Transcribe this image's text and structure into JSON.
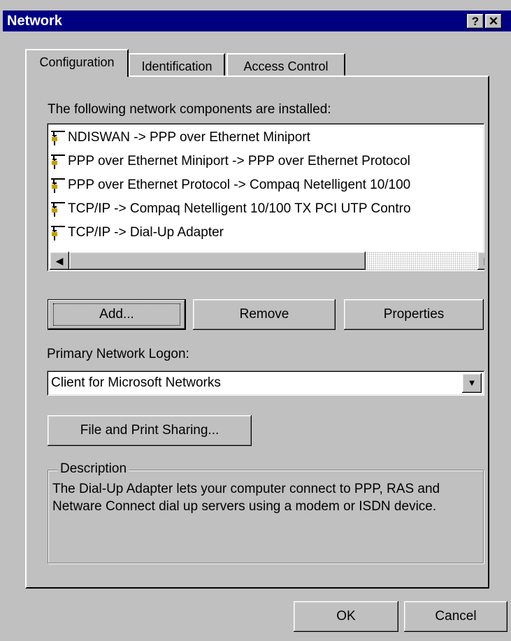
{
  "window": {
    "title": "Network",
    "help_label": "?",
    "close_label": "✕"
  },
  "tabs": [
    {
      "label": "Configuration",
      "active": true
    },
    {
      "label": "Identification",
      "active": false
    },
    {
      "label": "Access Control",
      "active": false
    }
  ],
  "components": {
    "heading": "The following network components are installed:",
    "items": [
      {
        "icon": "network-cable-icon",
        "label": "NDISWAN -> PPP over Ethernet Miniport"
      },
      {
        "icon": "network-cable-icon",
        "label": "PPP over Ethernet Miniport -> PPP over Ethernet Protocol"
      },
      {
        "icon": "network-cable-icon",
        "label": "PPP over Ethernet Protocol -> Compaq Netelligent 10/100"
      },
      {
        "icon": "network-cable-icon",
        "label": "TCP/IP -> Compaq Netelligent 10/100 TX PCI UTP Contro"
      },
      {
        "icon": "network-cable-icon",
        "label": "TCP/IP -> Dial-Up Adapter"
      }
    ]
  },
  "buttons": {
    "add": "Add...",
    "remove": "Remove",
    "properties": "Properties",
    "file_print": "File and Print Sharing...",
    "ok": "OK",
    "cancel": "Cancel"
  },
  "logon": {
    "label": "Primary Network Logon:",
    "value": "Client for Microsoft Networks"
  },
  "description": {
    "legend": "Description",
    "text": "The Dial-Up Adapter lets your computer connect to PPP, RAS and Netware Connect dial up servers using a modem or ISDN device."
  },
  "colors": {
    "titlebar": "#000080",
    "face": "#c0c0c0"
  }
}
